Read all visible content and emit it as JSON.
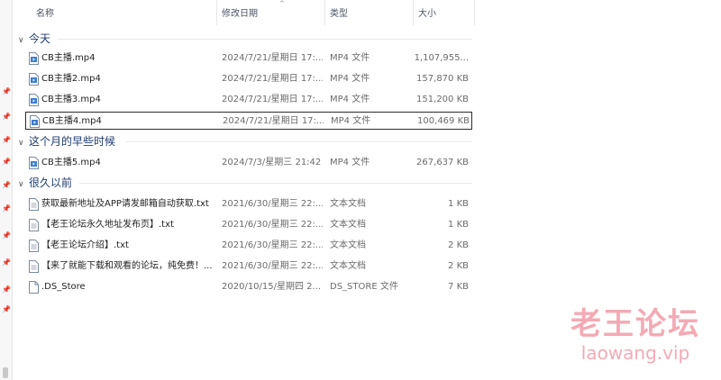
{
  "columns": {
    "name": "名称",
    "date": "修改日期",
    "type": "类型",
    "size": "大小"
  },
  "groups": [
    {
      "label": "今天",
      "items": [
        {
          "name": "CB主播.mp4",
          "date": "2024/7/21/星期日 17:...",
          "type": "MP4 文件",
          "size": "1,107,955...",
          "icon": "mp4-file-icon"
        },
        {
          "name": "CB主播2.mp4",
          "date": "2024/7/21/星期日 17:...",
          "type": "MP4 文件",
          "size": "157,870 KB",
          "icon": "mp4-file-icon"
        },
        {
          "name": "CB主播3.mp4",
          "date": "2024/7/21/星期日 17:...",
          "type": "MP4 文件",
          "size": "151,200 KB",
          "icon": "mp4-file-icon"
        },
        {
          "name": "CB主播4.mp4",
          "date": "2024/7/21/星期日 17:...",
          "type": "MP4 文件",
          "size": "100,469 KB",
          "icon": "mp4-file-icon"
        }
      ]
    },
    {
      "label": "这个月的早些时候",
      "items": [
        {
          "name": "CB主播5.mp4",
          "date": "2024/7/3/星期三 21:42",
          "type": "MP4 文件",
          "size": "267,637 KB",
          "icon": "mp4-file-icon"
        }
      ]
    },
    {
      "label": "很久以前",
      "items": [
        {
          "name": "获取最新地址及APP请发邮箱自动获取.txt",
          "date": "2021/6/30/星期三 22:...",
          "type": "文本文档",
          "size": "1 KB",
          "icon": "text-file-icon"
        },
        {
          "name": "【老王论坛永久地址发布页】.txt",
          "date": "2021/6/30/星期三 22:...",
          "type": "文本文档",
          "size": "1 KB",
          "icon": "text-file-icon"
        },
        {
          "name": "【老王论坛介绍】.txt",
          "date": "2021/6/30/星期三 22:...",
          "type": "文本文档",
          "size": "2 KB",
          "icon": "text-file-icon"
        },
        {
          "name": "【来了就能下载和观看的论坛，纯免费！...",
          "date": "2021/6/30/星期三 22:...",
          "type": "文本文档",
          "size": "2 KB",
          "icon": "text-file-icon"
        },
        {
          "name": ".DS_Store",
          "date": "2020/10/15/星期四 2...",
          "type": "DS_STORE 文件",
          "size": "7 KB",
          "icon": "generic-file-icon"
        }
      ]
    }
  ],
  "selected": "CB主播4.mp4",
  "watermark": {
    "title": "老王论坛",
    "url": "laowang.vip"
  },
  "colors": {
    "group_text": "#1e3a6e",
    "watermark": "#f3aab5",
    "selection_border": "#2b2b2b"
  }
}
